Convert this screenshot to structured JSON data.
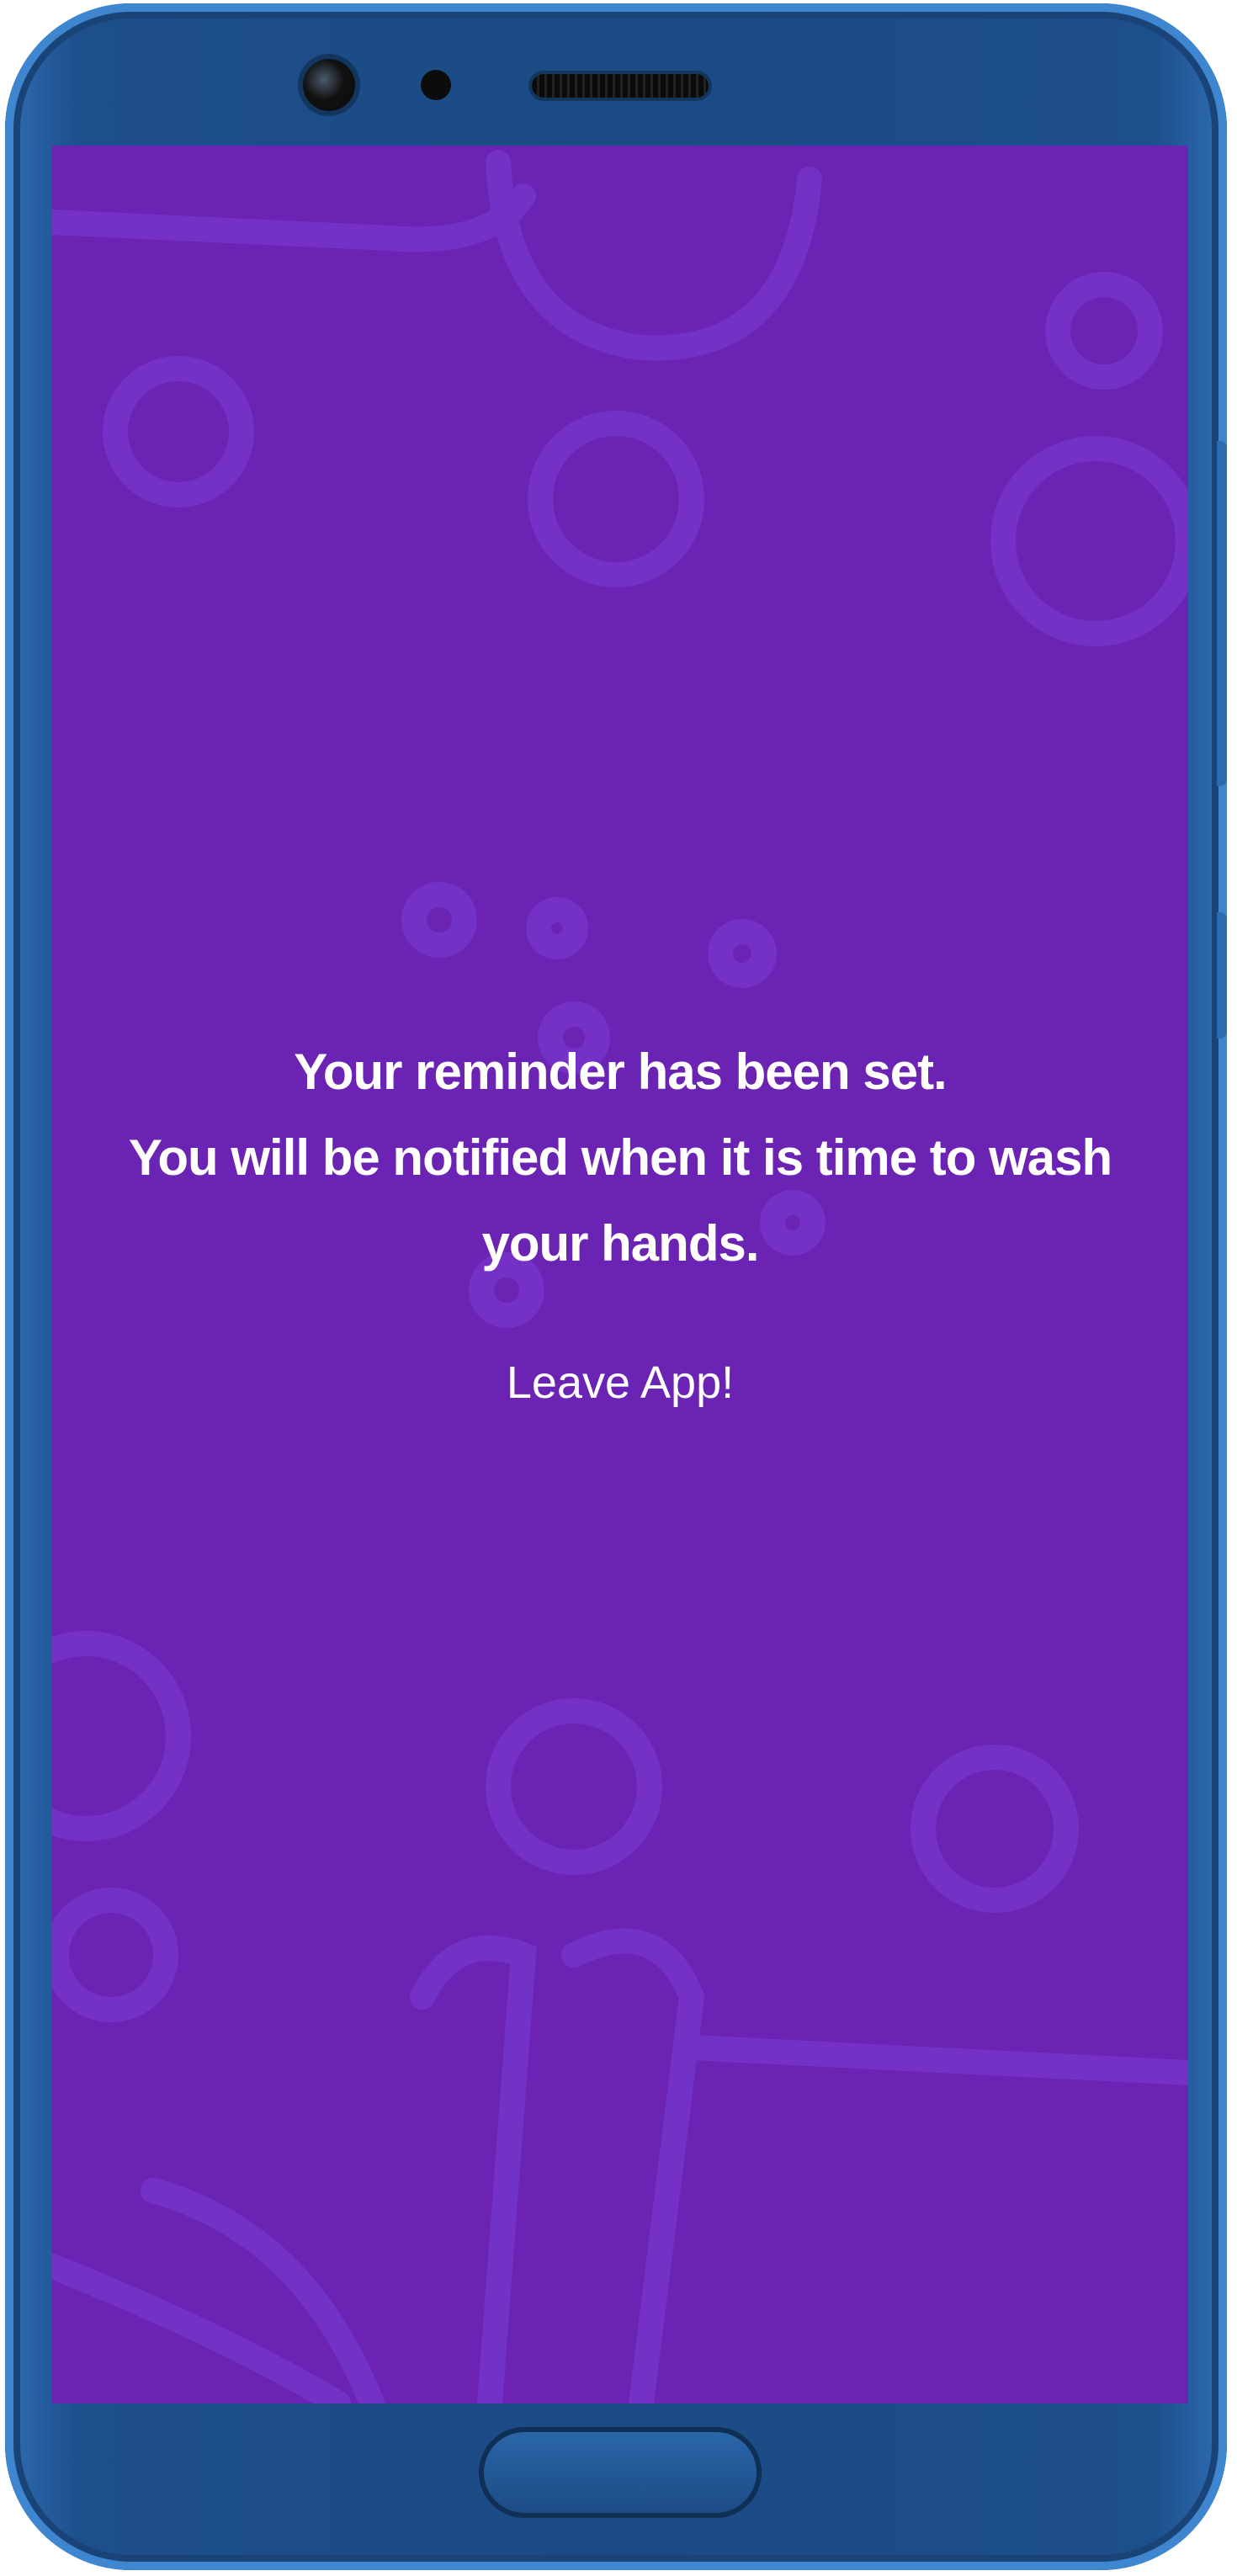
{
  "screen": {
    "background_color": "#6b23b4",
    "pattern_color": "#7a3bd0",
    "message_lines": [
      "Your reminder has been set.",
      "You will be notified when it is time to wash",
      "your hands."
    ],
    "leave_button_label": "Leave App!"
  },
  "device": {
    "frame_color": "#1b4a84",
    "icons": [
      "front-camera-icon",
      "sensor-icon",
      "speaker-grille-icon",
      "home-button"
    ]
  }
}
